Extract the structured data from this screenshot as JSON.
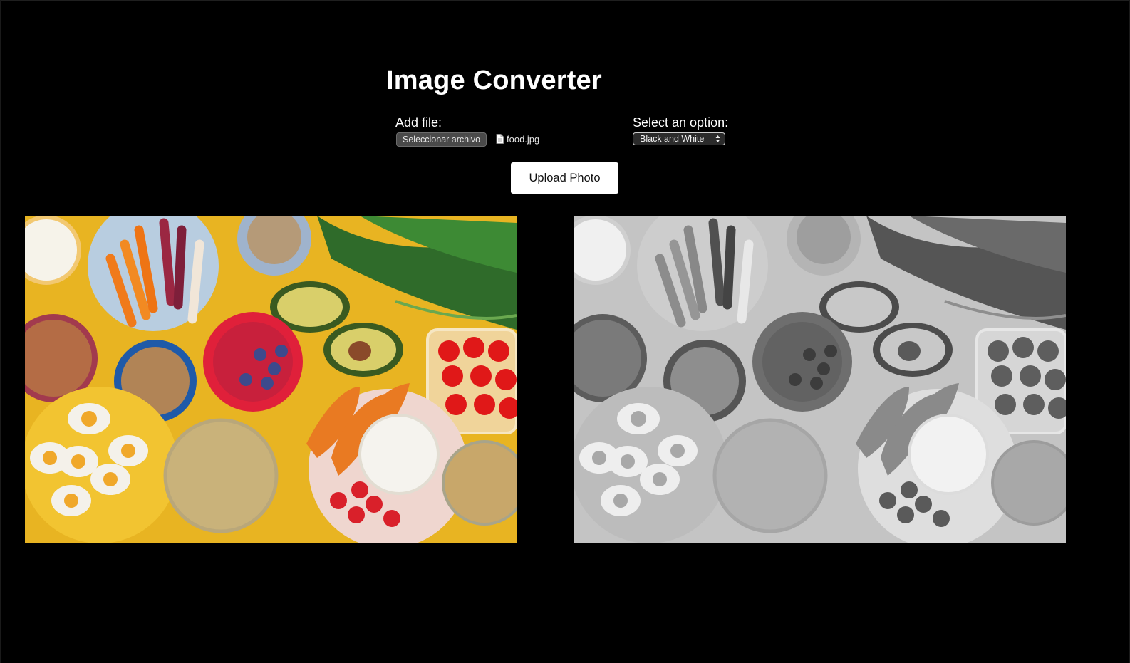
{
  "page": {
    "title": "Image Converter"
  },
  "file_input": {
    "label": "Add file:",
    "button_label": "Seleccionar archivo",
    "file_name": "food.jpg",
    "icon": "document-icon"
  },
  "option_select": {
    "label": "Select an option:",
    "selected_value": "Black and White",
    "icon": "select-arrows-icon"
  },
  "upload": {
    "button_label": "Upload Photo"
  },
  "images": {
    "original": {
      "subject": "food",
      "mode": "color",
      "background_color": "#e8b422"
    },
    "converted": {
      "subject": "food",
      "mode": "Black and White",
      "background_color": "#c4c4c4"
    }
  },
  "colors": {
    "background": "#000000",
    "text": "#ffffff",
    "upload_button_bg": "#ffffff",
    "upload_button_text": "#111111"
  }
}
